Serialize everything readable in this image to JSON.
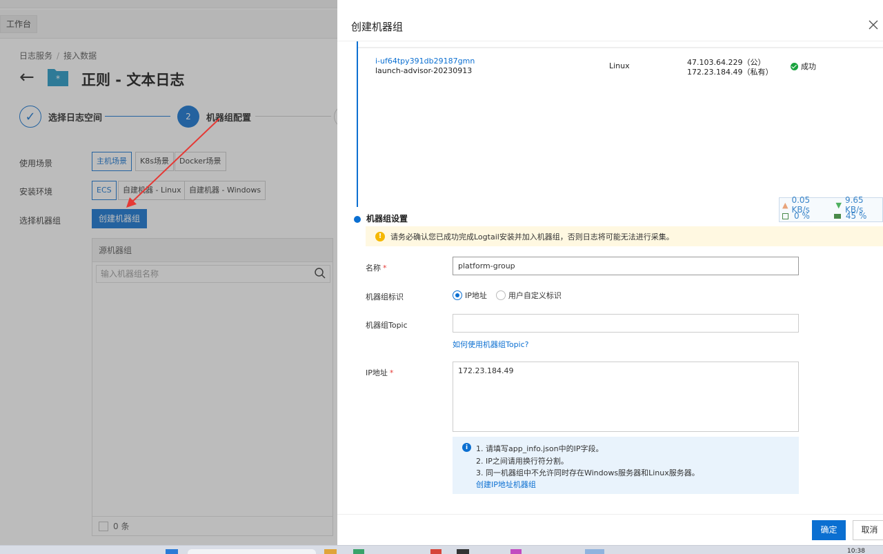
{
  "background": {
    "workbench_label": "工作台",
    "breadcrumb": [
      "日志服务",
      "接入数据"
    ],
    "page_title": "正则 - 文本日志",
    "steps": [
      {
        "num": "✓",
        "label": "选择日志空间"
      },
      {
        "num": "2",
        "label": "机器组配置"
      }
    ],
    "usage_scene": {
      "label": "使用场景",
      "options": [
        "主机场景",
        "K8s场景",
        "Docker场景"
      ],
      "selected": "主机场景"
    },
    "install_env": {
      "label": "安装环境",
      "options": [
        "ECS",
        "自建机器 - Linux",
        "自建机器 - Windows"
      ],
      "selected": "ECS"
    },
    "select_group": {
      "label": "选择机器组",
      "button": "创建机器组"
    },
    "group_panel": {
      "header": "源机器组",
      "search_placeholder": "输入机器组名称",
      "footer_count": "0 条"
    }
  },
  "drawer": {
    "title": "创建机器组",
    "instance": {
      "id": "i-uf64tpy391db29187gmn",
      "name": "launch-advisor-20230913",
      "os": "Linux",
      "ip_public": "47.103.64.229（公）",
      "ip_private": "172.23.184.49（私有）",
      "status": "成功"
    },
    "section_title": "机器组设置",
    "warning": "请务必确认您已成功完成Logtail安装并加入机器组，否则日志将可能无法进行采集。",
    "fields": {
      "name_label": "名称",
      "name_value": "platform-group",
      "id_label": "机器组标识",
      "id_options": [
        "IP地址",
        "用户自定义标识"
      ],
      "id_selected": "IP地址",
      "topic_label": "机器组Topic",
      "topic_value": "",
      "topic_help": "如何使用机器组Topic?",
      "ip_label": "IP地址",
      "ip_value": "172.23.184.49"
    },
    "tips": [
      "1. 请填写app_info.json中的IP字段。",
      "2. IP之间请用换行符分割。",
      "3. 同一机器组中不允许同时存在Windows服务器和Linux服务器。"
    ],
    "tips_link": "创建IP地址机器组",
    "ok_button": "确定",
    "cancel_button": "取消"
  },
  "network_widget": {
    "upload": "0.05 KB/s",
    "download": "9.65 KB/s",
    "cpu": "0 %",
    "memory": "45 %"
  },
  "taskbar": {
    "time": "10:38"
  },
  "colors": {
    "primary": "#0b6fd1",
    "warning_bg": "#fff8e1",
    "info_bg": "#e9f3fc",
    "required": "#e53935",
    "success": "#1aa33f"
  }
}
